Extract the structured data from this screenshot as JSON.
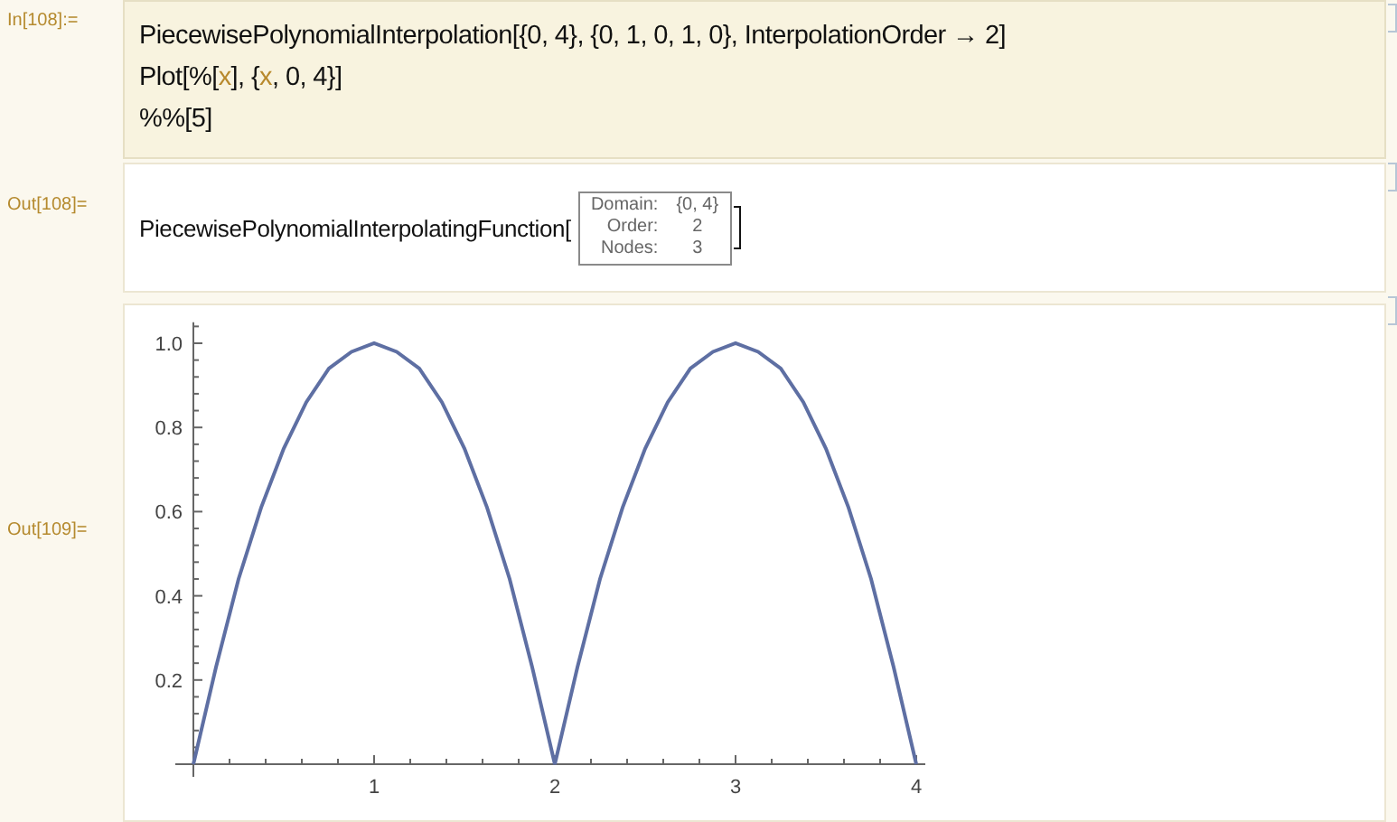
{
  "cells": [
    {
      "kind": "input",
      "label": "In[108]:=",
      "lines": [
        [
          {
            "text": "PiecewisePolynomialInterpolation[{0, 4}, {0, 1, 0, 1, 0}, InterpolationOrder → 2]",
            "kind": "plain"
          }
        ],
        [
          {
            "text": "Plot[%[",
            "kind": "plain"
          },
          {
            "text": "x",
            "kind": "symbol"
          },
          {
            "text": "], {",
            "kind": "plain"
          },
          {
            "text": "x",
            "kind": "symbol"
          },
          {
            "text": ", 0, 4}]",
            "kind": "plain"
          }
        ],
        [
          {
            "text": "%%[5]",
            "kind": "plain"
          }
        ]
      ]
    },
    {
      "kind": "summary",
      "label": "Out[108]=",
      "head": "PiecewisePolynomialInterpolatingFunction[",
      "rows": [
        {
          "key": "Domain:",
          "value": "{0, 4}"
        },
        {
          "key": "Order:",
          "value": "2"
        },
        {
          "key": "Nodes:",
          "value": "3"
        }
      ]
    },
    {
      "kind": "plot",
      "label": "Out[109]=",
      "chart_data": {
        "type": "line",
        "xlim": [
          -0.1,
          4.05
        ],
        "ylim": [
          -0.03,
          1.05
        ],
        "xticks": [
          1,
          2,
          3,
          4
        ],
        "yticks": [
          0.2,
          0.4,
          0.6,
          0.8,
          {
            "value": 1,
            "label": "1.0"
          }
        ],
        "series": [
          {
            "color": "#5e6fa3",
            "values": [
              0,
              0.23,
              0.44,
              0.61,
              0.75,
              0.86,
              0.94,
              0.98,
              1,
              0.98,
              0.94,
              0.86,
              0.75,
              0.61,
              0.44,
              0.23,
              0,
              0.23,
              0.44,
              0.61,
              0.75,
              0.86,
              0.94,
              0.98,
              1,
              0.98,
              0.94,
              0.86,
              0.75,
              0.61,
              0.44,
              0.23,
              0
            ]
          }
        ],
        "x": [
          0,
          0.125,
          0.25,
          0.375,
          0.5,
          0.625,
          0.75,
          0.875,
          1,
          1.125,
          1.25,
          1.375,
          1.5,
          1.625,
          1.75,
          1.875,
          2,
          2.125,
          2.25,
          2.375,
          2.5,
          2.625,
          2.75,
          2.875,
          3,
          3.125,
          3.25,
          3.375,
          3.5,
          3.625,
          3.75,
          3.875,
          4
        ]
      }
    }
  ]
}
